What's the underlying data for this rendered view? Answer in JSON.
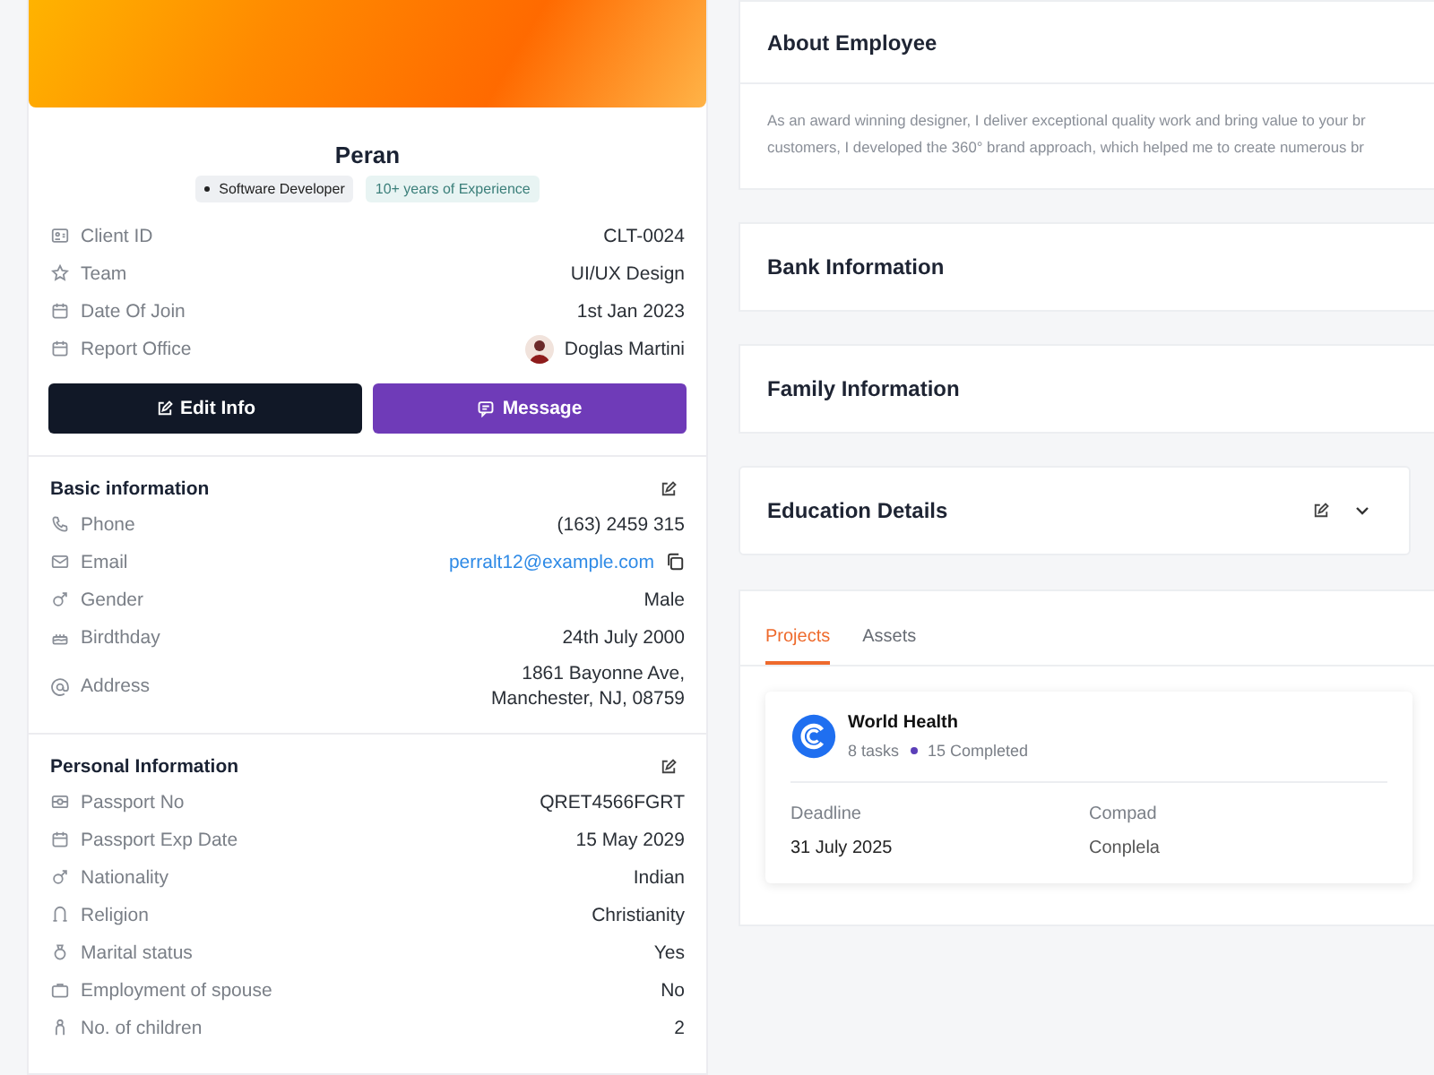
{
  "profile": {
    "name": "Peran",
    "tags": [
      {
        "label": "Software Developer",
        "kind": "role"
      },
      {
        "label": "10+ years of Experience",
        "kind": "experience"
      }
    ],
    "details": [
      {
        "label": "Client ID",
        "value": "CLT-0024"
      },
      {
        "label": "Team",
        "value": "UI/UX Design"
      },
      {
        "label": "Date Of Join",
        "value": "1st Jan 2023"
      },
      {
        "label": "Report Office",
        "value": "Doglas Martini",
        "kind": "person"
      }
    ],
    "buttons": [
      {
        "label": "Edit Info",
        "kind": "dark"
      },
      {
        "label": "Message",
        "kind": "primary"
      }
    ]
  },
  "basic_information": {
    "title": "Basic information",
    "rows": [
      {
        "label": "Phone",
        "value": "(163) 2459 315"
      },
      {
        "label": "Email",
        "value": "perralt12@example.com",
        "kind": "link"
      },
      {
        "label": "Gender",
        "value": "Male"
      },
      {
        "label": "Birdthday",
        "value": "24th July 2000"
      },
      {
        "label": "Address",
        "value": "1861 Bayonne Ave,",
        "value_2": "Manchester, NJ, 08759"
      }
    ]
  },
  "personal_information": {
    "title": "Personal Information",
    "rows": [
      {
        "label": "Passport No",
        "value": "QRET4566FGRT"
      },
      {
        "label": "Passport Exp Date",
        "value": "15 May 2029"
      },
      {
        "label": "Nationality",
        "value": "Indian"
      },
      {
        "label": "Religion",
        "value": "Christianity"
      },
      {
        "label": "Marital status",
        "value": "Yes"
      },
      {
        "label": "Employment of spouse",
        "value": "No"
      },
      {
        "label": "No. of children",
        "value": "2"
      }
    ]
  },
  "about": {
    "title": "About Employee",
    "lines": [
      "As an award winning designer, I deliver exceptional quality work and bring value to your br",
      "customers, I developed the 360° brand approach, which helped me to create numerous br"
    ]
  },
  "sections": [
    {
      "title": "Bank Information"
    },
    {
      "title": "Family Information"
    },
    {
      "title": "Education Details",
      "kind": "actions"
    }
  ],
  "tabs": [
    {
      "label": "Projects",
      "selected": true
    },
    {
      "label": "Assets",
      "selected": false
    }
  ],
  "project": {
    "name": "World Health",
    "tasks": "8 tasks",
    "completed": "15 Completed",
    "deadline_label": "Deadline",
    "deadline": "31 July 2025",
    "column_2": [
      "Compad",
      "Conplela"
    ]
  }
}
